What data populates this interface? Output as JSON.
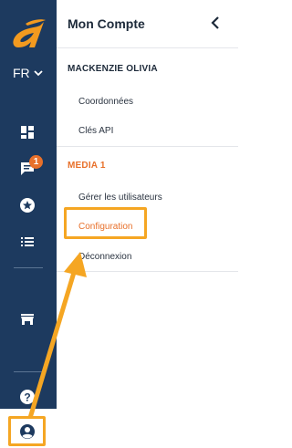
{
  "rail": {
    "language": "FR",
    "badge_count": "1",
    "icons": [
      "dashboard-icon",
      "chat-icon",
      "star-icon",
      "list-icon",
      "store-icon",
      "help-icon",
      "profile-icon"
    ]
  },
  "panel": {
    "title": "Mon Compte",
    "account_section": {
      "name": "MACKENZIE OLIVIA",
      "items": [
        "Coordonnées",
        "Clés API"
      ]
    },
    "media_section": {
      "name": "MEDIA 1",
      "items": [
        "Gérer les utilisateurs",
        "Configuration",
        "Déconnexion"
      ]
    }
  },
  "colors": {
    "rail_bg": "#1d3a5f",
    "accent": "#e8702a",
    "highlight": "#f5a623"
  }
}
